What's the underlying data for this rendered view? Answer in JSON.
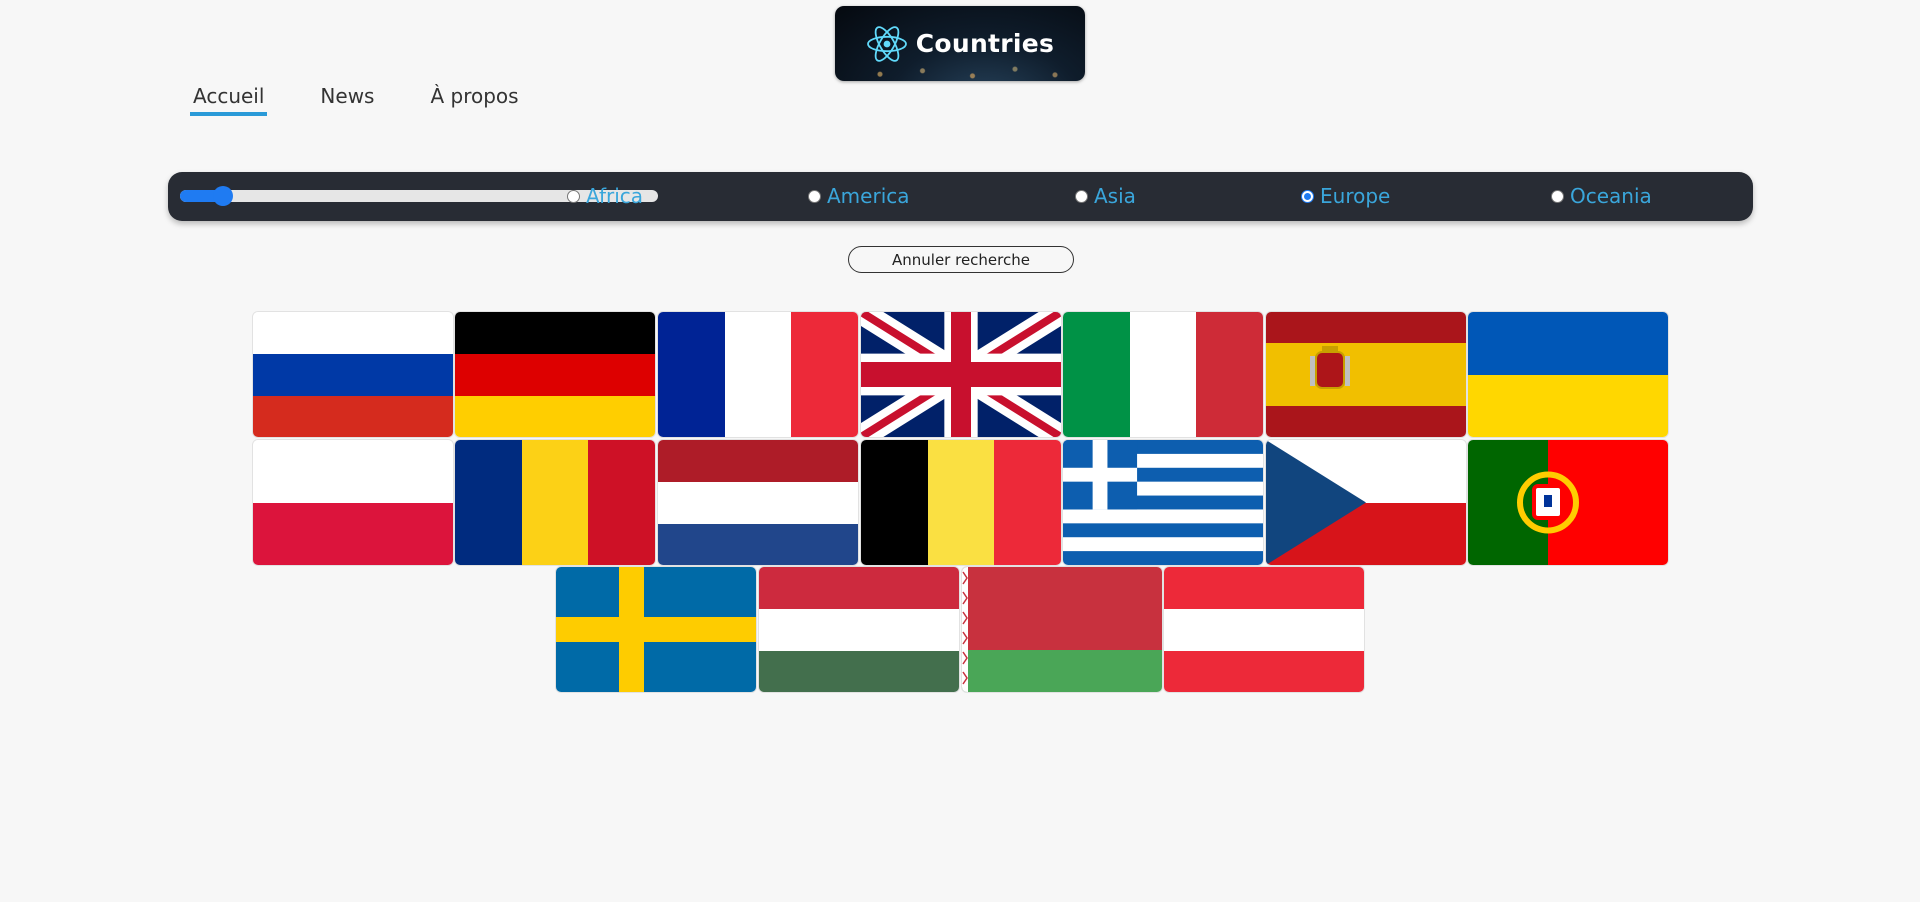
{
  "logo": {
    "text": "Countries",
    "icon": "react-atom-icon"
  },
  "nav": {
    "items": [
      "Accueil",
      "News",
      "À propos"
    ],
    "active": "Accueil"
  },
  "filter": {
    "range_slider": {
      "value_fraction": 0.09
    },
    "regions": [
      {
        "label": "Africa",
        "checked": false
      },
      {
        "label": "America",
        "checked": false
      },
      {
        "label": "Asia",
        "checked": false
      },
      {
        "label": "Europe",
        "checked": true
      },
      {
        "label": "Oceania",
        "checked": false
      }
    ]
  },
  "cancel_button": {
    "label": "Annuler recherche"
  },
  "flags": [
    "russia",
    "germany",
    "france",
    "united-kingdom",
    "italy",
    "spain",
    "ukraine",
    "poland",
    "romania",
    "netherlands",
    "belgium",
    "greece",
    "czechia",
    "portugal",
    "sweden",
    "hungary",
    "belarus",
    "austria"
  ],
  "colors": {
    "accent": "#2a9ad8",
    "bar": "#282c34",
    "slider": "#1f7bf2",
    "label": "#3aa6db"
  }
}
